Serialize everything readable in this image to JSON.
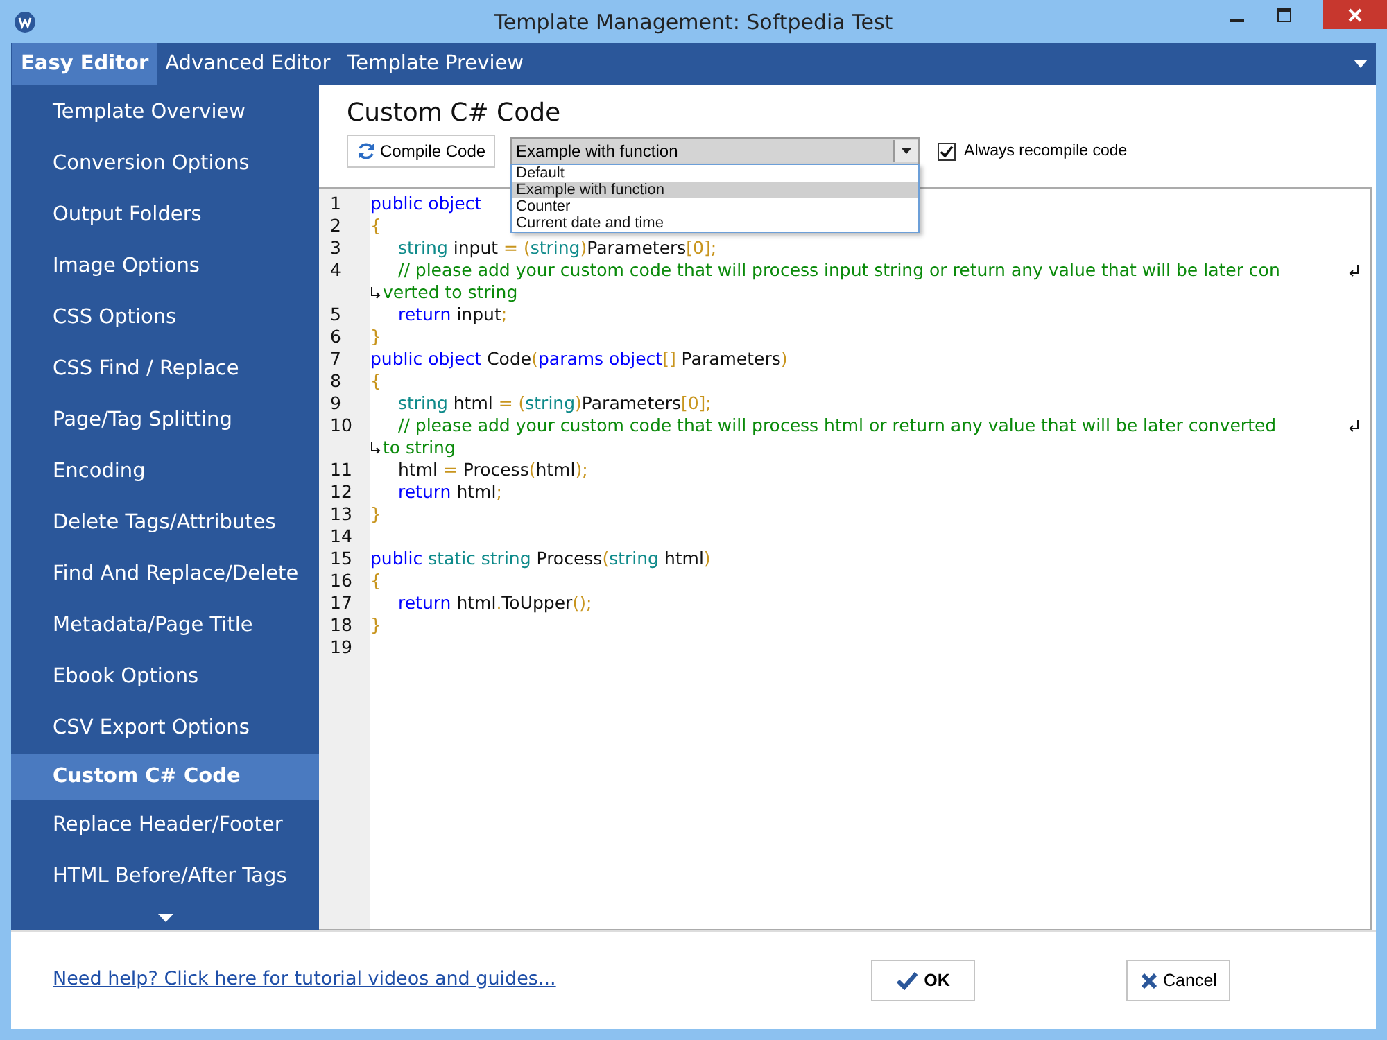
{
  "window": {
    "title": "Template Management: Softpedia Test"
  },
  "tabs": [
    {
      "label": "Easy Editor",
      "selected": true
    },
    {
      "label": "Advanced Editor",
      "selected": false
    },
    {
      "label": "Template Preview",
      "selected": false
    }
  ],
  "sidebar": {
    "items": [
      {
        "label": "Template Overview",
        "selected": false
      },
      {
        "label": "Conversion Options",
        "selected": false
      },
      {
        "label": "Output Folders",
        "selected": false
      },
      {
        "label": "Image Options",
        "selected": false
      },
      {
        "label": "CSS Options",
        "selected": false
      },
      {
        "label": "CSS Find / Replace",
        "selected": false
      },
      {
        "label": "Page/Tag Splitting",
        "selected": false
      },
      {
        "label": "Encoding",
        "selected": false
      },
      {
        "label": "Delete Tags/Attributes",
        "selected": false
      },
      {
        "label": "Find And Replace/Delete",
        "selected": false
      },
      {
        "label": "Metadata/Page Title",
        "selected": false
      },
      {
        "label": "Ebook Options",
        "selected": false
      },
      {
        "label": "CSV Export Options",
        "selected": false
      },
      {
        "label": "Custom C# Code",
        "selected": true
      },
      {
        "label": "Replace Header/Footer",
        "selected": false
      },
      {
        "label": "HTML Before/After Tags",
        "selected": false
      }
    ]
  },
  "content": {
    "title": "Custom C# Code",
    "compile_button": "Compile Code",
    "example_select": {
      "value": "Example with function",
      "expanded": true,
      "options": [
        {
          "label": "Default",
          "selected": false
        },
        {
          "label": "Example with function",
          "selected": true
        },
        {
          "label": "Counter",
          "selected": false
        },
        {
          "label": "Current date and time",
          "selected": false
        }
      ]
    },
    "always_recompile": {
      "label": "Always recompile code",
      "checked": true
    },
    "code_lines": [
      {
        "number": "1",
        "tokens": [
          {
            "kind": "keyword",
            "text": "public object"
          }
        ]
      },
      {
        "number": "2",
        "tokens": [
          {
            "kind": "punct",
            "text": "{"
          }
        ]
      },
      {
        "number": "3",
        "indent": true,
        "tokens": [
          {
            "kind": "type",
            "text": "string"
          },
          {
            "kind": "plain",
            "text": " input "
          },
          {
            "kind": "punct",
            "text": "= ("
          },
          {
            "kind": "type",
            "text": "string"
          },
          {
            "kind": "punct",
            "text": ")"
          },
          {
            "kind": "plain",
            "text": "Parameters"
          },
          {
            "kind": "punct",
            "text": "[0];"
          }
        ]
      },
      {
        "number": "4",
        "indent": true,
        "tokens": [
          {
            "kind": "comment",
            "text": "// please add your custom code that will process input string or return any value that will be later con"
          }
        ],
        "wrap": [
          {
            "kind": "comment",
            "text": "verted to string"
          }
        ]
      },
      {
        "number": "5",
        "indent": true,
        "tokens": [
          {
            "kind": "keyword",
            "text": "return"
          },
          {
            "kind": "plain",
            "text": " input"
          },
          {
            "kind": "punct",
            "text": ";"
          }
        ]
      },
      {
        "number": "6",
        "tokens": [
          {
            "kind": "punct",
            "text": "}"
          }
        ]
      },
      {
        "number": "7",
        "tokens": [
          {
            "kind": "keyword",
            "text": "public object"
          },
          {
            "kind": "plain",
            "text": " Code"
          },
          {
            "kind": "punct",
            "text": "("
          },
          {
            "kind": "keyword",
            "text": "params object"
          },
          {
            "kind": "punct",
            "text": "[]"
          },
          {
            "kind": "plain",
            "text": " Parameters"
          },
          {
            "kind": "punct",
            "text": ")"
          }
        ]
      },
      {
        "number": "8",
        "tokens": [
          {
            "kind": "punct",
            "text": "{"
          }
        ]
      },
      {
        "number": "9",
        "indent": true,
        "tokens": [
          {
            "kind": "type",
            "text": "string"
          },
          {
            "kind": "plain",
            "text": " html "
          },
          {
            "kind": "punct",
            "text": "= ("
          },
          {
            "kind": "type",
            "text": "string"
          },
          {
            "kind": "punct",
            "text": ")"
          },
          {
            "kind": "plain",
            "text": "Parameters"
          },
          {
            "kind": "punct",
            "text": "[0];"
          }
        ]
      },
      {
        "number": "10",
        "indent": true,
        "tokens": [
          {
            "kind": "comment",
            "text": "// please add your custom code that will process html or return any value that will be later converted"
          }
        ],
        "wrap": [
          {
            "kind": "comment",
            "text": "to string"
          }
        ]
      },
      {
        "number": "11",
        "indent": true,
        "tokens": [
          {
            "kind": "plain",
            "text": "html "
          },
          {
            "kind": "punct",
            "text": "="
          },
          {
            "kind": "plain",
            "text": " Process"
          },
          {
            "kind": "punct",
            "text": "("
          },
          {
            "kind": "plain",
            "text": "html"
          },
          {
            "kind": "punct",
            "text": ");"
          }
        ]
      },
      {
        "number": "12",
        "indent": true,
        "tokens": [
          {
            "kind": "keyword",
            "text": "return"
          },
          {
            "kind": "plain",
            "text": " html"
          },
          {
            "kind": "punct",
            "text": ";"
          }
        ]
      },
      {
        "number": "13",
        "tokens": [
          {
            "kind": "punct",
            "text": "}"
          }
        ]
      },
      {
        "number": "14"
      },
      {
        "number": "15",
        "tokens": [
          {
            "kind": "keyword",
            "text": "public"
          },
          {
            "kind": "type",
            "text": " static string"
          },
          {
            "kind": "plain",
            "text": " Process"
          },
          {
            "kind": "punct",
            "text": "("
          },
          {
            "kind": "type",
            "text": "string"
          },
          {
            "kind": "plain",
            "text": " html"
          },
          {
            "kind": "punct",
            "text": ")"
          }
        ]
      },
      {
        "number": "16",
        "tokens": [
          {
            "kind": "punct",
            "text": "{"
          }
        ]
      },
      {
        "number": "17",
        "indent": true,
        "tokens": [
          {
            "kind": "keyword",
            "text": "return"
          },
          {
            "kind": "plain",
            "text": " html"
          },
          {
            "kind": "punct",
            "text": "."
          },
          {
            "kind": "plain",
            "text": "ToUpper"
          },
          {
            "kind": "punct",
            "text": "();"
          }
        ]
      },
      {
        "number": "18",
        "tokens": [
          {
            "kind": "punct",
            "text": "}"
          }
        ]
      },
      {
        "number": "19"
      }
    ]
  },
  "footer": {
    "help_link": "Need help? Click here for tutorial videos and guides...",
    "ok_button": "OK",
    "cancel_button": "Cancel"
  }
}
